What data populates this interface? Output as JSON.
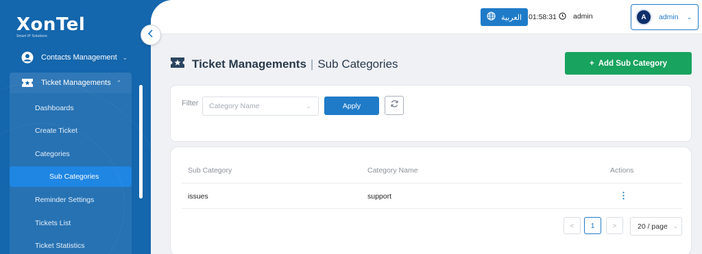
{
  "brand": {
    "name": "XonTel",
    "tagline": "Smart IP Solutions"
  },
  "sidebar": {
    "sections": [
      {
        "label": "Contacts Management",
        "icon": "user-circle-icon",
        "expanded": false
      },
      {
        "label": "Ticket Managements",
        "icon": "ticket-icon",
        "expanded": true
      }
    ],
    "sub_items": [
      {
        "label": "Dashboards",
        "active": false
      },
      {
        "label": "Create Ticket",
        "active": false
      },
      {
        "label": "Categories",
        "active": false
      },
      {
        "label": "Sub Categories",
        "active": true
      },
      {
        "label": "Reminder Settings",
        "active": false
      },
      {
        "label": "Tickets List",
        "active": false
      },
      {
        "label": "Ticket Statistics",
        "active": false
      }
    ]
  },
  "topbar": {
    "language_label": "العربية",
    "time": "01:58:31",
    "username": "admin",
    "avatar_initial": "A",
    "account_name": "admin"
  },
  "page": {
    "title": "Ticket Managements",
    "separator": "|",
    "subtitle": "Sub Categories",
    "add_button_label": "Add Sub Category",
    "add_button_prefix": "+"
  },
  "filter": {
    "label": "Filter",
    "select_placeholder": "Category Name",
    "apply_label": "Apply"
  },
  "table": {
    "columns": [
      "Sub Category",
      "Category Name",
      "Actions"
    ],
    "rows": [
      {
        "sub_category": "issues",
        "category_name": "support"
      }
    ]
  },
  "pagination": {
    "prev": "<",
    "current_page": "1",
    "next": ">",
    "page_size": "20 / page"
  },
  "colors": {
    "sidebar_bg": "#1466ad",
    "accent": "#1f7bc8",
    "success": "#18a35e"
  }
}
